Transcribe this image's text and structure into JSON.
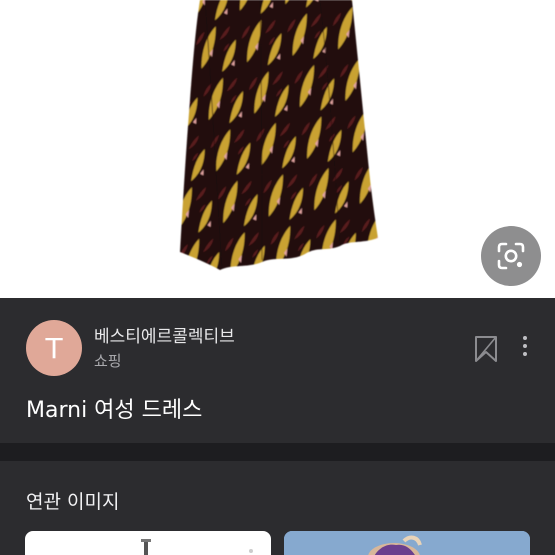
{
  "product_image": {
    "pattern_colors": {
      "dark": "#24100f",
      "mustard": "#c9a233",
      "maroon": "#5a1a1e",
      "pink": "#e2a3a0"
    },
    "lens_icon": "image-search-icon"
  },
  "source": {
    "avatar_letter": "T",
    "avatar_color": "#e0a898",
    "name": "베스티에르콜렉티브",
    "category": "쇼핑"
  },
  "product": {
    "title": "Marni 여성 드레스"
  },
  "actions": {
    "bookmark_icon": "bookmark-icon",
    "more_icon": "more-vertical-icon"
  },
  "related": {
    "heading": "연관 이미지"
  }
}
